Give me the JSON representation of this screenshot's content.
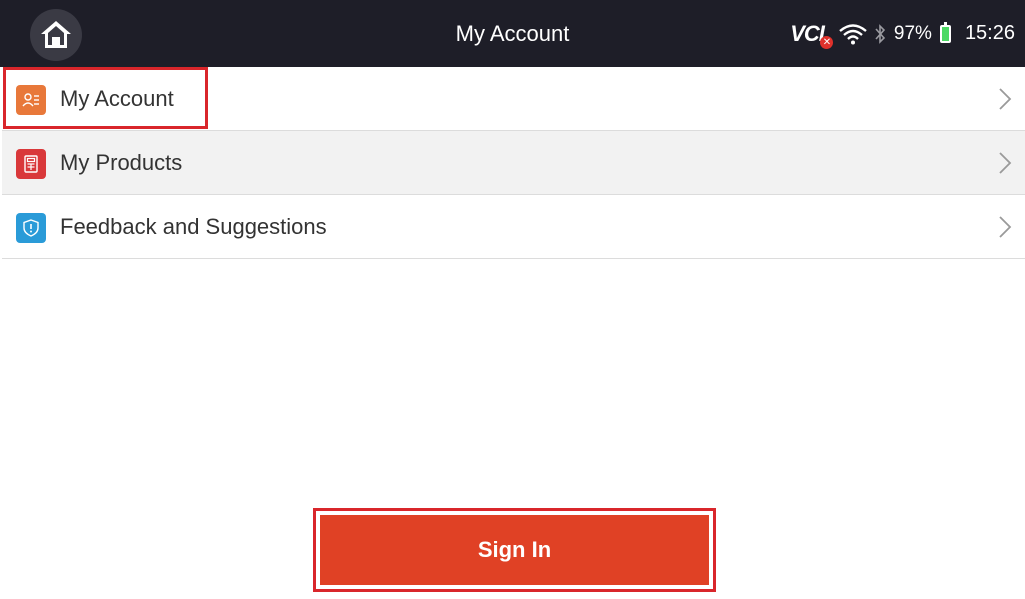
{
  "header": {
    "title": "My Account",
    "home_icon": "home-icon"
  },
  "status_bar": {
    "vci_label": "VCI",
    "battery_percent": "97%",
    "time": "15:26",
    "icons": [
      "vci-disconnected-icon",
      "wifi-icon",
      "bluetooth-icon",
      "battery-charging-icon"
    ]
  },
  "menu": {
    "items": [
      {
        "label": "My Account",
        "icon": "account-card-icon",
        "icon_color": "#e8783a"
      },
      {
        "label": "My Products",
        "icon": "product-device-icon",
        "icon_color": "#d9383a"
      },
      {
        "label": "Feedback and Suggestions",
        "icon": "shield-alert-icon",
        "icon_color": "#2a9bd8"
      }
    ]
  },
  "actions": {
    "sign_in_label": "Sign In"
  },
  "colors": {
    "topbar": "#1e1e28",
    "accent": "#e04125",
    "highlight": "#d9262b"
  }
}
